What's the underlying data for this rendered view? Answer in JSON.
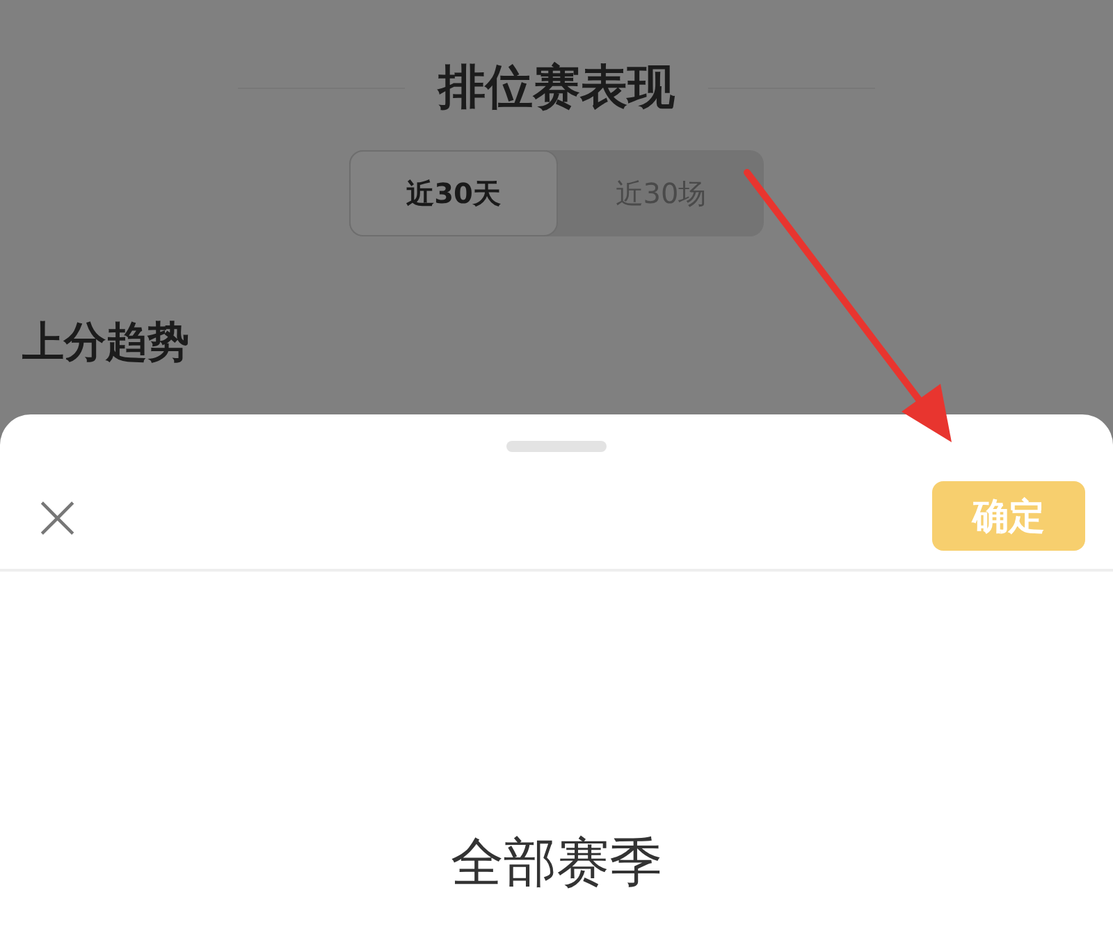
{
  "page": {
    "title": "排位赛表现"
  },
  "tabs": [
    {
      "label": "近30天",
      "selected": true
    },
    {
      "label": "近30场",
      "selected": false
    }
  ],
  "section": {
    "title": "上分趋势"
  },
  "sheet": {
    "close": "×",
    "confirm": {
      "label": "确定",
      "disabled": true
    },
    "options": [
      {
        "label": "全部赛季"
      }
    ]
  }
}
